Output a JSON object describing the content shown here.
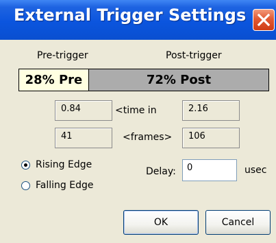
{
  "window": {
    "title": "External Trigger Settings"
  },
  "trigger": {
    "pre_label": "Pre-trigger",
    "post_label": "Post-trigger",
    "pre_bar_text": "28% Pre",
    "post_bar_text": "72% Post",
    "pre_fraction": 0.28,
    "post_fraction": 0.72
  },
  "time_row": {
    "pre_value": "0.84",
    "label": "<time in",
    "post_value": "2.16"
  },
  "frames_row": {
    "pre_value": "41",
    "label": "<frames>",
    "post_value": "106"
  },
  "edge": {
    "rising_label": "Rising Edge",
    "falling_label": "Falling Edge",
    "selected": "Rising Edge"
  },
  "delay": {
    "label": "Delay:",
    "value": "0",
    "unit": "usec"
  },
  "buttons": {
    "ok_label": "OK",
    "cancel_label": "Cancel"
  },
  "colors": {
    "titlebar": "#0b55de",
    "close_button": "#e15a34",
    "pre_bar": "#ffffe1",
    "post_bar": "#acacac",
    "dialog_bg": "#ece9d8"
  },
  "icons": {
    "close": "close-icon"
  }
}
